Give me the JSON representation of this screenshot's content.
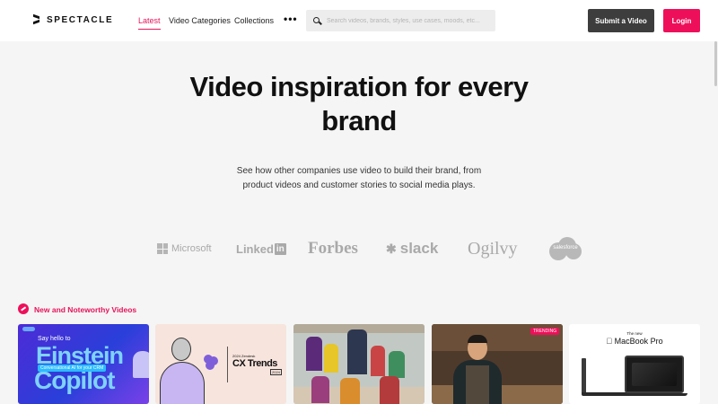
{
  "brand": {
    "name": "SPECTACLE"
  },
  "nav": {
    "links": [
      "Latest",
      "Video Categories",
      "Collections"
    ],
    "more": "•••",
    "search_placeholder": "Search videos, brands, styles, use cases, moods, etc...",
    "submit_label": "Submit a Video",
    "login_label": "Login"
  },
  "hero": {
    "title": "Video inspiration for every brand",
    "subtitle": "See how other companies use video to build their brand, from product videos and customer stories to social media plays."
  },
  "brands": [
    "Microsoft",
    "Linked",
    "in",
    "Forbes",
    "slack",
    "Ogilvy",
    "salesforce"
  ],
  "section": {
    "title": "New and Noteworthy Videos"
  },
  "cards": [
    {
      "line1": "Say hello to",
      "line2": "Einstein",
      "line3": "Conversational AI for your CRM",
      "line4": "Copilot"
    },
    {
      "small": "2024 Zendesk",
      "title": "CX Trends",
      "year": "2024"
    },
    {},
    {
      "tag": "TRENDING"
    },
    {
      "eyebrow": "The new",
      "title": "MacBook Pro"
    }
  ],
  "colors": {
    "accent": "#ee0f5a",
    "submit_bg": "#3d3d3d",
    "page_bg": "#f5f5f5"
  }
}
